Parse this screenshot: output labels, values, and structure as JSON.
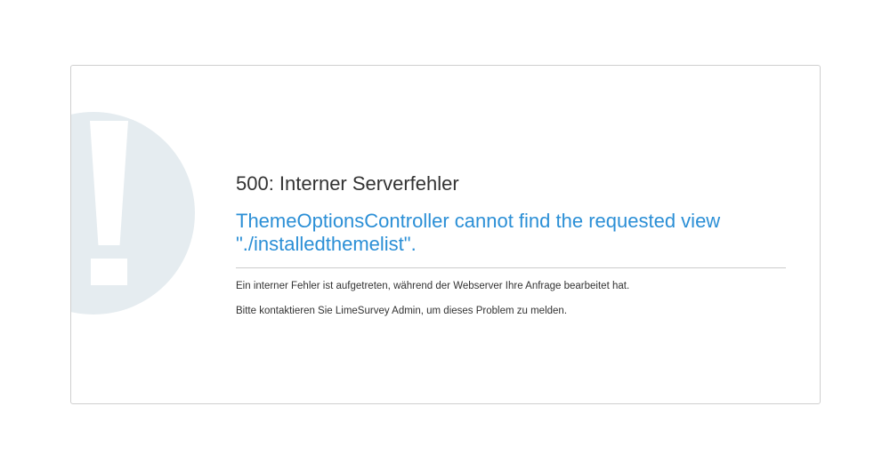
{
  "error": {
    "code_title": "500: Interner Serverfehler",
    "message": "ThemeOptionsController cannot find the requested view \"./installedthemelist\".",
    "description": "Ein interner Fehler ist aufgetreten, während der Webserver Ihre Anfrage bearbeitet hat.",
    "contact": "Bitte kontaktieren Sie LimeSurvey Admin, um dieses Problem zu melden."
  },
  "icons": {
    "alert": "exclamation-icon"
  },
  "colors": {
    "accent": "#2b8fd6",
    "icon_background": "#e5ecf0",
    "border": "#cfcfcf",
    "text": "#333333"
  }
}
